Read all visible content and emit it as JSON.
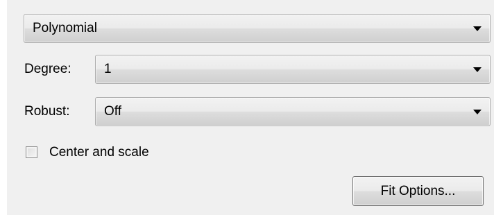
{
  "fit_type": {
    "selected": "Polynomial"
  },
  "degree": {
    "label": "Degree:",
    "selected": "1"
  },
  "robust": {
    "label": "Robust:",
    "selected": "Off"
  },
  "center_and_scale": {
    "label": "Center and scale",
    "checked": false
  },
  "fit_options_button": {
    "label": "Fit Options..."
  },
  "icons": {
    "dropdown_arrow": "chevron-down-icon"
  }
}
